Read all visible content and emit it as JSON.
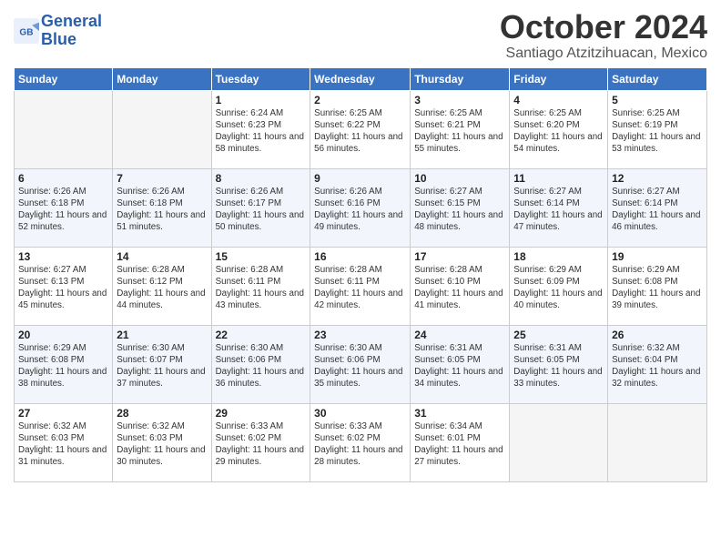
{
  "header": {
    "logo_line1": "General",
    "logo_line2": "Blue",
    "month": "October 2024",
    "location": "Santiago Atzitzihuacan, Mexico"
  },
  "days_of_week": [
    "Sunday",
    "Monday",
    "Tuesday",
    "Wednesday",
    "Thursday",
    "Friday",
    "Saturday"
  ],
  "weeks": [
    [
      {
        "day": "",
        "info": ""
      },
      {
        "day": "",
        "info": ""
      },
      {
        "day": "1",
        "info": "Sunrise: 6:24 AM\nSunset: 6:23 PM\nDaylight: 11 hours and 58 minutes."
      },
      {
        "day": "2",
        "info": "Sunrise: 6:25 AM\nSunset: 6:22 PM\nDaylight: 11 hours and 56 minutes."
      },
      {
        "day": "3",
        "info": "Sunrise: 6:25 AM\nSunset: 6:21 PM\nDaylight: 11 hours and 55 minutes."
      },
      {
        "day": "4",
        "info": "Sunrise: 6:25 AM\nSunset: 6:20 PM\nDaylight: 11 hours and 54 minutes."
      },
      {
        "day": "5",
        "info": "Sunrise: 6:25 AM\nSunset: 6:19 PM\nDaylight: 11 hours and 53 minutes."
      }
    ],
    [
      {
        "day": "6",
        "info": "Sunrise: 6:26 AM\nSunset: 6:18 PM\nDaylight: 11 hours and 52 minutes."
      },
      {
        "day": "7",
        "info": "Sunrise: 6:26 AM\nSunset: 6:18 PM\nDaylight: 11 hours and 51 minutes."
      },
      {
        "day": "8",
        "info": "Sunrise: 6:26 AM\nSunset: 6:17 PM\nDaylight: 11 hours and 50 minutes."
      },
      {
        "day": "9",
        "info": "Sunrise: 6:26 AM\nSunset: 6:16 PM\nDaylight: 11 hours and 49 minutes."
      },
      {
        "day": "10",
        "info": "Sunrise: 6:27 AM\nSunset: 6:15 PM\nDaylight: 11 hours and 48 minutes."
      },
      {
        "day": "11",
        "info": "Sunrise: 6:27 AM\nSunset: 6:14 PM\nDaylight: 11 hours and 47 minutes."
      },
      {
        "day": "12",
        "info": "Sunrise: 6:27 AM\nSunset: 6:14 PM\nDaylight: 11 hours and 46 minutes."
      }
    ],
    [
      {
        "day": "13",
        "info": "Sunrise: 6:27 AM\nSunset: 6:13 PM\nDaylight: 11 hours and 45 minutes."
      },
      {
        "day": "14",
        "info": "Sunrise: 6:28 AM\nSunset: 6:12 PM\nDaylight: 11 hours and 44 minutes."
      },
      {
        "day": "15",
        "info": "Sunrise: 6:28 AM\nSunset: 6:11 PM\nDaylight: 11 hours and 43 minutes."
      },
      {
        "day": "16",
        "info": "Sunrise: 6:28 AM\nSunset: 6:11 PM\nDaylight: 11 hours and 42 minutes."
      },
      {
        "day": "17",
        "info": "Sunrise: 6:28 AM\nSunset: 6:10 PM\nDaylight: 11 hours and 41 minutes."
      },
      {
        "day": "18",
        "info": "Sunrise: 6:29 AM\nSunset: 6:09 PM\nDaylight: 11 hours and 40 minutes."
      },
      {
        "day": "19",
        "info": "Sunrise: 6:29 AM\nSunset: 6:08 PM\nDaylight: 11 hours and 39 minutes."
      }
    ],
    [
      {
        "day": "20",
        "info": "Sunrise: 6:29 AM\nSunset: 6:08 PM\nDaylight: 11 hours and 38 minutes."
      },
      {
        "day": "21",
        "info": "Sunrise: 6:30 AM\nSunset: 6:07 PM\nDaylight: 11 hours and 37 minutes."
      },
      {
        "day": "22",
        "info": "Sunrise: 6:30 AM\nSunset: 6:06 PM\nDaylight: 11 hours and 36 minutes."
      },
      {
        "day": "23",
        "info": "Sunrise: 6:30 AM\nSunset: 6:06 PM\nDaylight: 11 hours and 35 minutes."
      },
      {
        "day": "24",
        "info": "Sunrise: 6:31 AM\nSunset: 6:05 PM\nDaylight: 11 hours and 34 minutes."
      },
      {
        "day": "25",
        "info": "Sunrise: 6:31 AM\nSunset: 6:05 PM\nDaylight: 11 hours and 33 minutes."
      },
      {
        "day": "26",
        "info": "Sunrise: 6:32 AM\nSunset: 6:04 PM\nDaylight: 11 hours and 32 minutes."
      }
    ],
    [
      {
        "day": "27",
        "info": "Sunrise: 6:32 AM\nSunset: 6:03 PM\nDaylight: 11 hours and 31 minutes."
      },
      {
        "day": "28",
        "info": "Sunrise: 6:32 AM\nSunset: 6:03 PM\nDaylight: 11 hours and 30 minutes."
      },
      {
        "day": "29",
        "info": "Sunrise: 6:33 AM\nSunset: 6:02 PM\nDaylight: 11 hours and 29 minutes."
      },
      {
        "day": "30",
        "info": "Sunrise: 6:33 AM\nSunset: 6:02 PM\nDaylight: 11 hours and 28 minutes."
      },
      {
        "day": "31",
        "info": "Sunrise: 6:34 AM\nSunset: 6:01 PM\nDaylight: 11 hours and 27 minutes."
      },
      {
        "day": "",
        "info": ""
      },
      {
        "day": "",
        "info": ""
      }
    ]
  ]
}
